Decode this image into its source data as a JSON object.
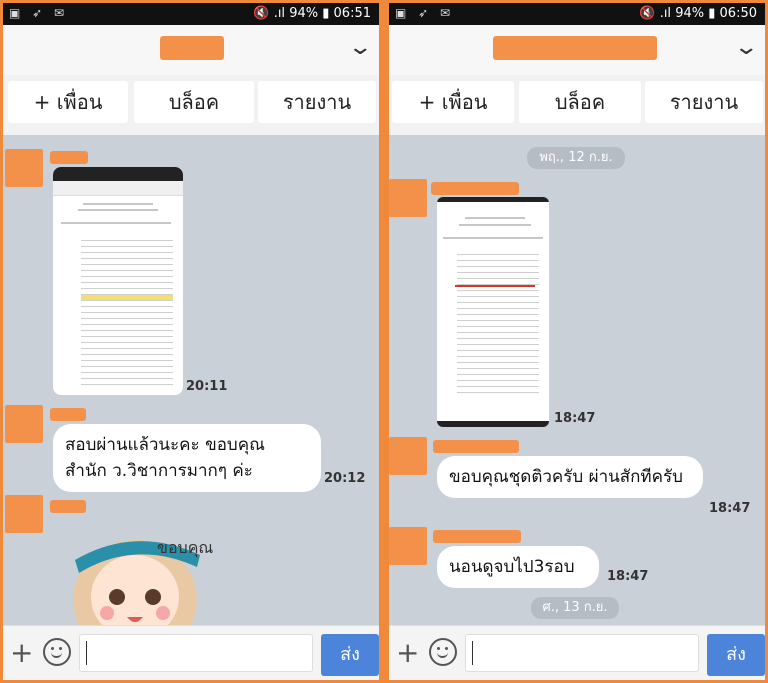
{
  "left": {
    "status": {
      "battery": "94%",
      "time": "06:51"
    },
    "actions": {
      "friend": "+ เพื่อน",
      "block": "บล็อค",
      "report": "รายงาน"
    },
    "messages": [
      {
        "time": "20:11"
      },
      {
        "text": "สอบผ่านแล้วนะคะ ขอบคุณ สำนัก ว.วิชาการมากๆ ค่ะ",
        "time": "20:12"
      }
    ],
    "sticker_text": "ขอบคุณ นะคะ",
    "send": "ส่ง"
  },
  "right": {
    "status": {
      "battery": "94%",
      "time": "06:50"
    },
    "actions": {
      "friend": "+ เพื่อน",
      "block": "บล็อค",
      "report": "รายงาน"
    },
    "date1": "พฤ., 12 ก.ย.",
    "messages": [
      {
        "time": "18:47"
      },
      {
        "text": "ขอบคุณชุดติวครับ ผ่านสักทีครับ",
        "time": "18:47"
      },
      {
        "text": "นอนดูจบไป3รอบ",
        "time": "18:47"
      }
    ],
    "date2": "ศ., 13 ก.ย.",
    "send": "ส่ง"
  }
}
